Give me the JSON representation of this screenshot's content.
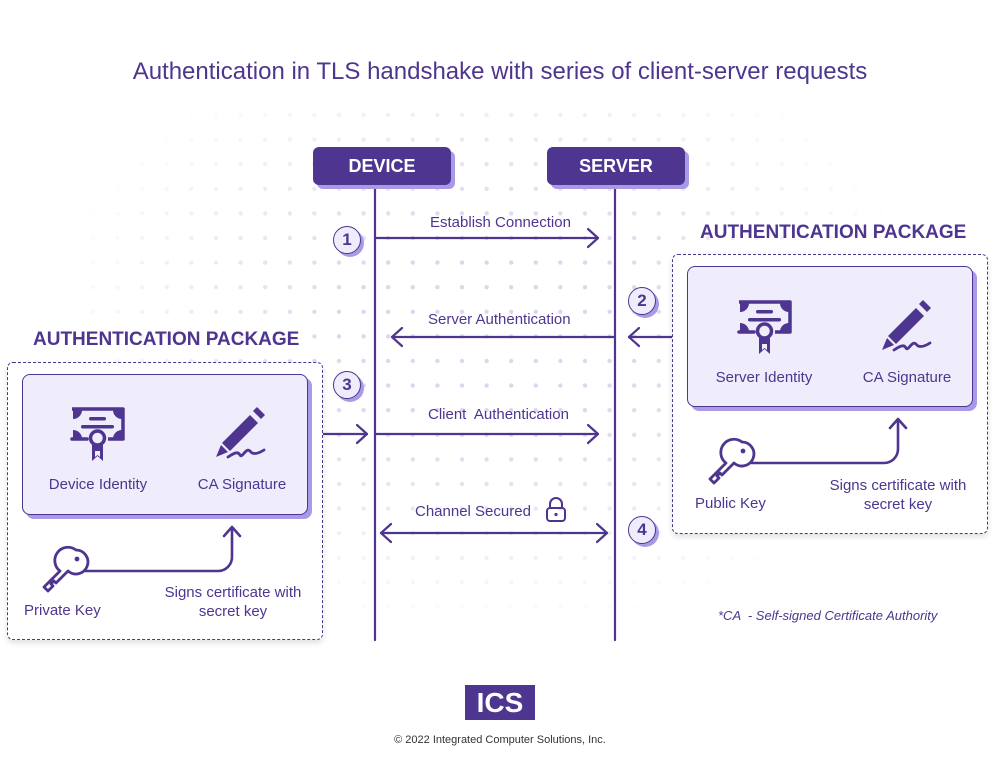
{
  "title": "Authentication in TLS handshake with series of client-server requests",
  "actors": {
    "device": "DEVICE",
    "server": "SERVER"
  },
  "messages": [
    {
      "step": "1",
      "label": "Establish Connection",
      "direction": "device-to-server"
    },
    {
      "step": "2",
      "label": "Server Authentication",
      "direction": "server-to-device"
    },
    {
      "step": "3",
      "label": "Client  Authentication",
      "direction": "device-to-server"
    },
    {
      "step": "4",
      "label": "Channel Secured",
      "direction": "bidirectional",
      "icon": "lock-icon"
    }
  ],
  "packages": {
    "client": {
      "title": "AUTHENTICATION PACKAGE",
      "identity_label": "Device Identity",
      "identity_icon": "certificate-icon",
      "signature_label": "CA Signature",
      "signature_icon": "pen-signature-icon",
      "key_label": "Private Key",
      "key_icon": "key-icon",
      "sign_note": "Signs certificate with secret key",
      "sign_note_line1": "Signs certificate with",
      "sign_note_line2": "secret key"
    },
    "server": {
      "title": "AUTHENTICATION PACKAGE",
      "identity_label": "Server Identity",
      "identity_icon": "certificate-icon",
      "signature_label": "CA Signature",
      "signature_icon": "pen-signature-icon",
      "key_label": "Public Key",
      "key_icon": "key-icon",
      "sign_note": "Signs certificate with secret key",
      "sign_note_line1": "Signs certificate with",
      "sign_note_line2": "secret key"
    }
  },
  "footnote": "*CA  - Self-signed Certificate Authority",
  "logo": "ICS",
  "copyright": "© 2022 Integrated Computer Solutions, Inc.",
  "colors": {
    "primary": "#4e3590",
    "accent_shadow": "#a99ae8",
    "panel_fill": "#efedfc",
    "dot": "#dcd7ee"
  }
}
